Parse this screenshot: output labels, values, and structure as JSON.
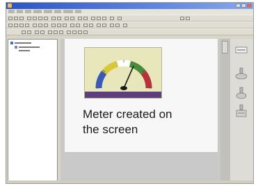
{
  "window": {
    "title": "",
    "accent_color": "#2a55c8"
  },
  "canvas": {
    "caption_line1": "Meter created on",
    "caption_line2": "the screen"
  },
  "meter": {
    "label": "",
    "colors": {
      "blue": "#3a5ab8",
      "yellow": "#d8c838",
      "green": "#4a8a3c",
      "red": "#b8323a",
      "needle": "#1a1a1a",
      "label_bg": "#5e3f7e"
    }
  },
  "icons": {
    "tree": [
      "folder-icon",
      "meter-icon"
    ],
    "right_panel": [
      "text-tool-icon",
      "hand-tool-icon",
      "upload-tool-icon",
      "download-tool-icon"
    ]
  }
}
